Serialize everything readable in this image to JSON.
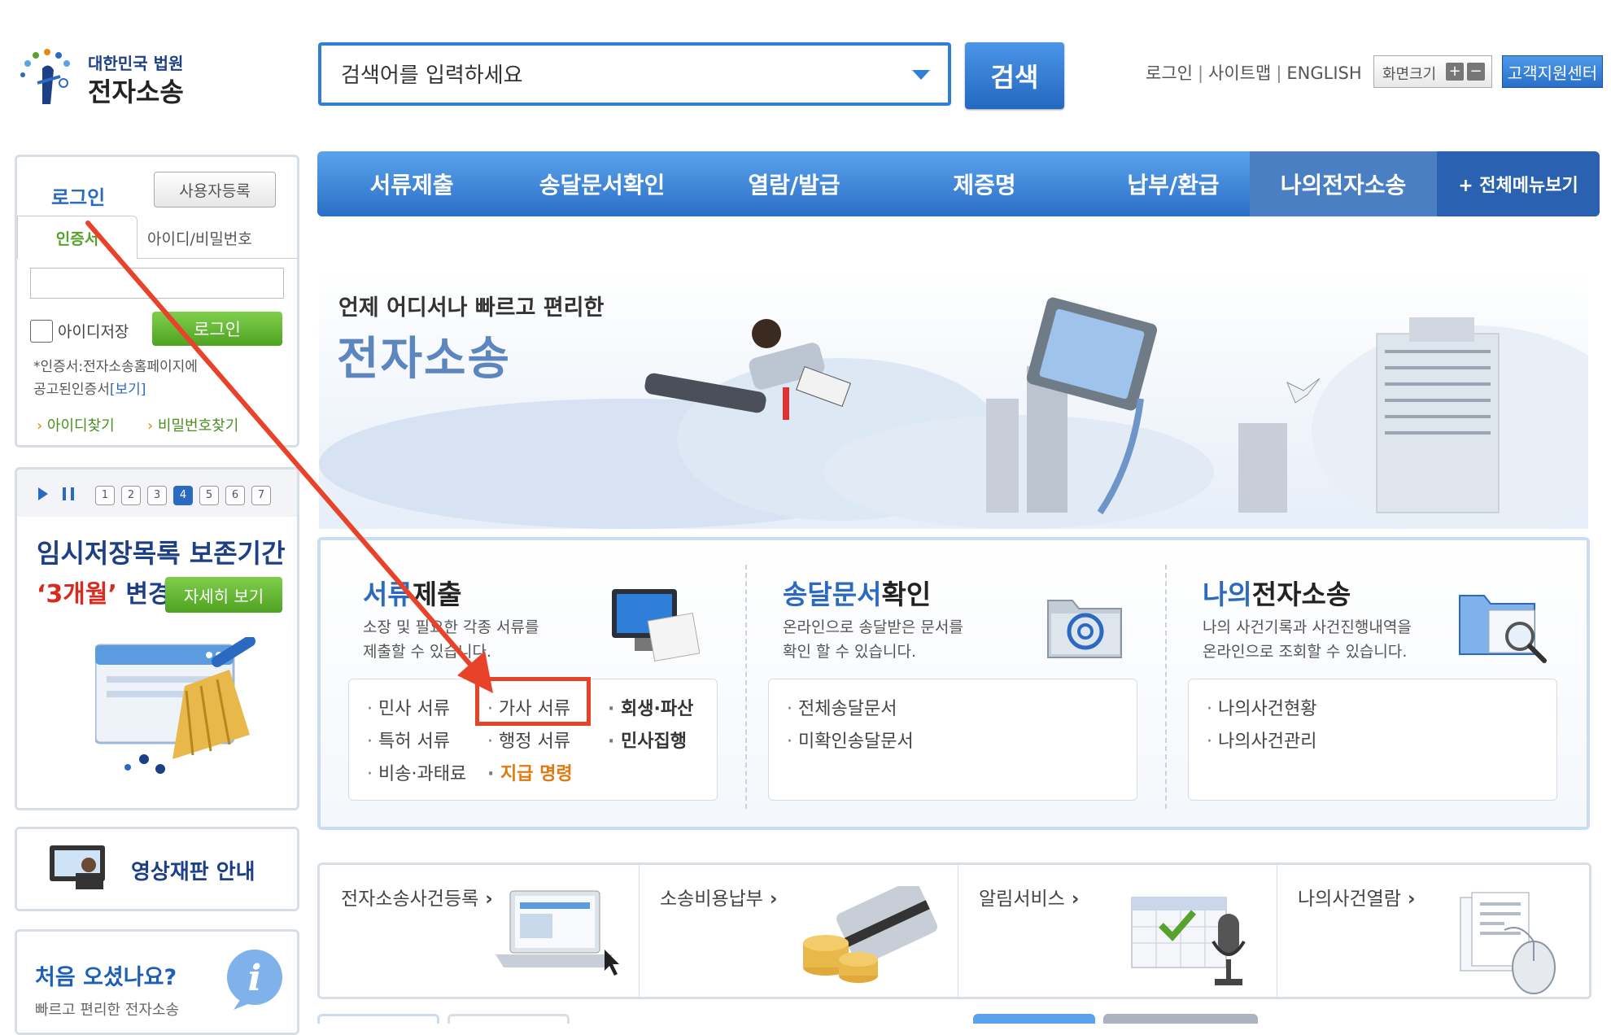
{
  "header": {
    "logo_small": "대한민국 법원",
    "logo_big": "전자소송",
    "search_placeholder": "검색어를 입력하세요",
    "search_button": "검색",
    "util_links": [
      "로그인",
      "사이트맵",
      "ENGLISH"
    ],
    "zoom_label": "화면크기",
    "zoom_in": "+",
    "zoom_out": "−",
    "customer_center": "고객지원센터"
  },
  "nav": {
    "items": [
      "서류제출",
      "송달문서확인",
      "열람/발급",
      "제증명",
      "납부/환급",
      "나의전자소송"
    ],
    "active_index": 5,
    "all_menu": "+ 전체메뉴보기"
  },
  "login": {
    "title": "로그인",
    "register_button": "사용자등록",
    "tab_cert": "인증서",
    "tab_id": "아이디/비밀번호",
    "remember_id": "아이디저장",
    "login_button": "로그인",
    "note_line1": "*인증서:전자소송홈페이지에",
    "note_line2": "공고된인증서",
    "note_link": "[보기]",
    "find_id": "아이디찾기",
    "find_pw": "비밀번호찾기"
  },
  "slider": {
    "pages": [
      "1",
      "2",
      "3",
      "4",
      "5",
      "6",
      "7"
    ],
    "current_page": 4,
    "title_line1": "임시저장목록 보존기간",
    "title_highlight": "‘3개월’",
    "title_rest": " 변경",
    "detail_button": "자세히 보기"
  },
  "video": {
    "label": "영상재판 안내"
  },
  "first_visit": {
    "title": "처음 오셨나요?",
    "subtitle": "빠르고 편리한 전자소송"
  },
  "hero": {
    "subtitle": "언제 어디서나 빠르고 편리한",
    "title": "전자소송"
  },
  "services": [
    {
      "title_blue": "서류",
      "title_rest": "제출",
      "desc_line1": "소장 및 필요한 각종 서류를",
      "desc_line2": "제출할 수 있습니다.",
      "links": [
        "민사 서류",
        "가사 서류",
        "회생·파산",
        "특허 서류",
        "행정 서류",
        "민사집행",
        "비송·과태료",
        "지급 명령"
      ]
    },
    {
      "title_blue": "송달문서",
      "title_rest": "확인",
      "desc_line1": "온라인으로 송달받은 문서를",
      "desc_line2": "확인 할 수 있습니다.",
      "links": [
        "전체송달문서",
        "미확인송달문서"
      ]
    },
    {
      "title_blue": "나의",
      "title_rest": "전자소송",
      "desc_line1": "나의 사건기록과 사건진행내역을",
      "desc_line2": "온라인으로 조회할 수 있습니다.",
      "links": [
        "나의사건현황",
        "나의사건관리"
      ]
    }
  ],
  "quick_links": [
    "전자소송사건등록",
    "소송비용납부",
    "알림서비스",
    "나의사건열람"
  ],
  "colors": {
    "primary_blue": "#2c6ac2",
    "green": "#57a22c",
    "annotation_red": "#e8432a",
    "orange": "#e07a10"
  },
  "icons": [
    "court-emblem-icon",
    "monitor-document-icon",
    "email-folder-icon",
    "folder-search-icon",
    "laptop-icon",
    "coins-card-icon",
    "calendar-mic-icon",
    "document-mouse-icon",
    "video-conference-icon",
    "info-icon",
    "broom-icon"
  ]
}
